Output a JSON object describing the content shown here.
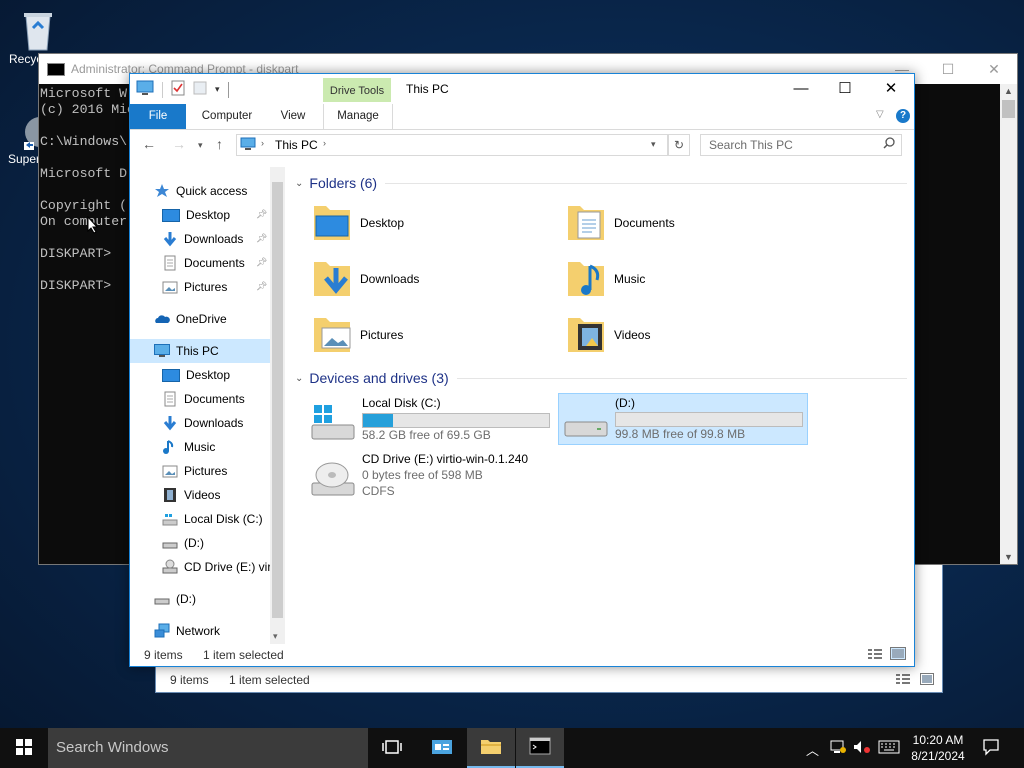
{
  "desktop": {
    "recycle_label": "Recyc",
    "super_label": "Super"
  },
  "cmd": {
    "title": "Administrator: Command Prompt - diskpart",
    "lines": "Microsoft W\n(c) 2016 Mic\n\nC:\\Windows\\\n\nMicrosoft D\n\nCopyright (\nOn computer\n\nDISKPART>\n\nDISKPART>"
  },
  "back_explorer": {
    "status_items": "9 items",
    "status_selected": "1 item selected"
  },
  "explorer": {
    "context_tab": "Drive Tools",
    "title": "This PC",
    "ribbon_tabs": {
      "file": "File",
      "computer": "Computer",
      "view": "View",
      "manage": "Manage"
    },
    "address": {
      "location": "This PC"
    },
    "search": {
      "placeholder": "Search This PC"
    },
    "nav": {
      "quick_access": "Quick access",
      "qa_desktop": "Desktop",
      "qa_downloads": "Downloads",
      "qa_documents": "Documents",
      "qa_pictures": "Pictures",
      "onedrive": "OneDrive",
      "this_pc": "This PC",
      "pc_desktop": "Desktop",
      "pc_documents": "Documents",
      "pc_downloads": "Downloads",
      "pc_music": "Music",
      "pc_pictures": "Pictures",
      "pc_videos": "Videos",
      "local_disk": "Local Disk (C:)",
      "d_drive": "(D:)",
      "cd_drive": "CD Drive (E:) virt",
      "d_drive2": "(D:)",
      "network": "Network"
    },
    "folders_header": "Folders (6)",
    "folders": {
      "desktop": "Desktop",
      "documents": "Documents",
      "downloads": "Downloads",
      "music": "Music",
      "pictures": "Pictures",
      "videos": "Videos"
    },
    "devices_header": "Devices and drives (3)",
    "drives": {
      "c": {
        "name": "Local Disk (C:)",
        "free": "58.2 GB free of 69.5 GB",
        "used_fraction": 0.16
      },
      "d": {
        "name": "(D:)",
        "free": "99.8 MB free of 99.8 MB",
        "used_fraction": 0.0
      },
      "e": {
        "name": "CD Drive (E:) virtio-win-0.1.240",
        "free": "0 bytes free of 598 MB",
        "fs": "CDFS"
      }
    },
    "status_items": "9 items",
    "status_selected": "1 item selected"
  },
  "taskbar": {
    "search_placeholder": "Search Windows",
    "time": "10:20 AM",
    "date": "8/21/2024"
  },
  "colors": {
    "accent": "#1979ca",
    "selection": "#cce8ff",
    "drive_bar": "#26a0da"
  }
}
